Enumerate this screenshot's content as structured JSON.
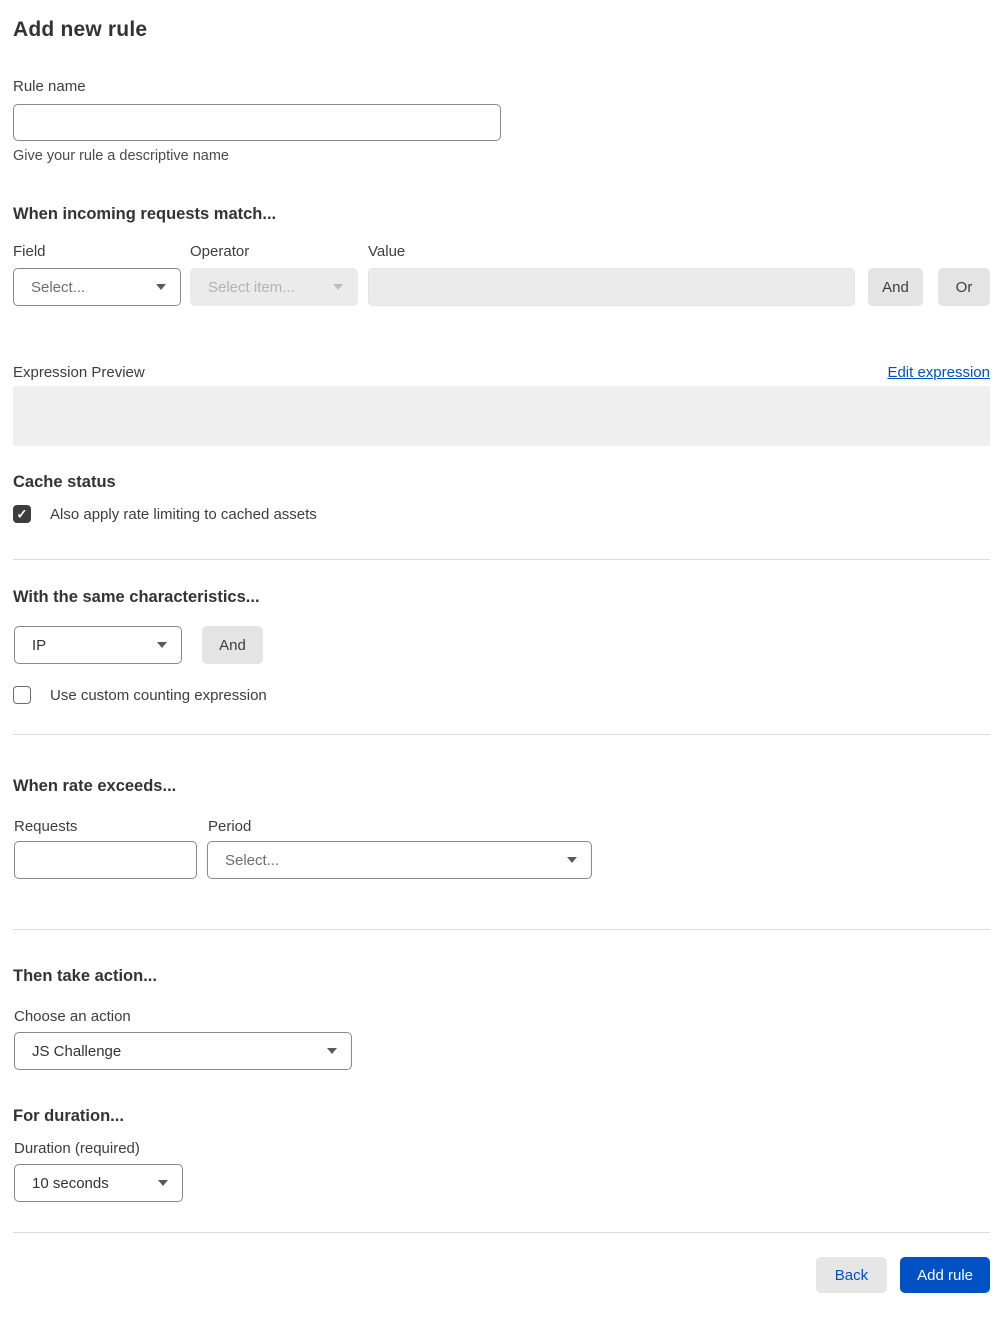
{
  "page": {
    "title": "Add new rule"
  },
  "rule_name": {
    "label": "Rule name",
    "value": "",
    "helper": "Give your rule a descriptive name"
  },
  "match": {
    "heading": "When incoming requests match...",
    "field": {
      "label": "Field",
      "selected": "Select..."
    },
    "operator": {
      "label": "Operator",
      "selected": "Select item...",
      "disabled": true
    },
    "value": {
      "label": "Value",
      "value": "",
      "disabled": true
    },
    "and_button": "And",
    "or_button": "Or"
  },
  "expression": {
    "label": "Expression Preview",
    "edit_link": "Edit expression",
    "preview_text": ""
  },
  "cache_status": {
    "heading": "Cache status",
    "checkbox_label": "Also apply rate limiting to cached assets",
    "checked": true
  },
  "characteristics": {
    "heading": "With the same characteristics...",
    "selected": "IP",
    "and_button": "And",
    "checkbox_label": "Use custom counting expression",
    "checked": false
  },
  "rate": {
    "heading": "When rate exceeds...",
    "requests_label": "Requests",
    "requests_value": "",
    "period_label": "Period",
    "period_selected": "Select..."
  },
  "action": {
    "heading": "Then take action...",
    "label": "Choose an action",
    "selected": "JS Challenge"
  },
  "duration": {
    "heading": "For duration...",
    "label": "Duration (required)",
    "selected": "10 seconds"
  },
  "footer": {
    "back_button": "Back",
    "submit_button": "Add rule"
  },
  "colors": {
    "accent_blue": "#0051c3",
    "checkbox_checked": "#3d3d3d",
    "disabled_bg": "#ebebeb",
    "preview_bg": "#efefef",
    "button_gray": "#e4e4e4"
  },
  "icons": {
    "chevron": "chevron-down-icon",
    "check": "check-icon"
  }
}
